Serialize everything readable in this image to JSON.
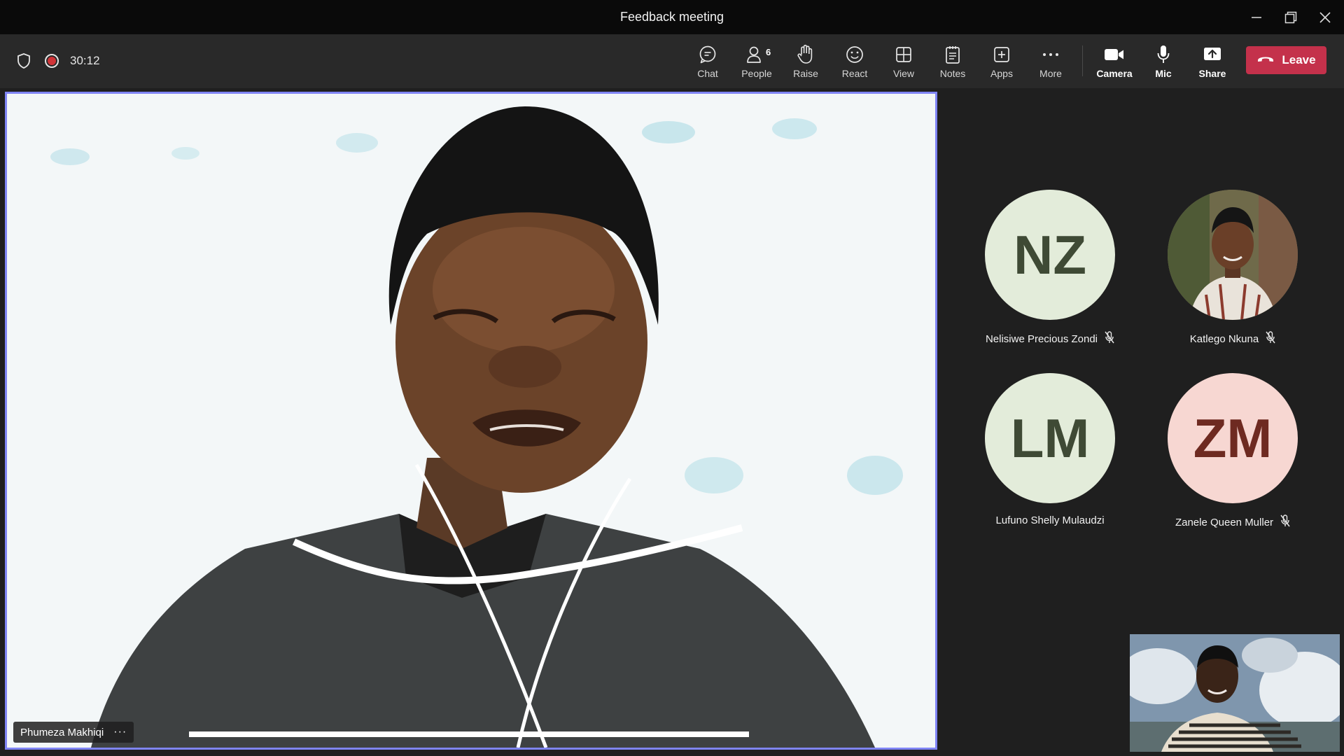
{
  "window": {
    "title": "Feedback meeting"
  },
  "status": {
    "timer": "30:12"
  },
  "toolbar": {
    "chat": "Chat",
    "people": "People",
    "people_count": "6",
    "raise": "Raise",
    "react": "React",
    "view": "View",
    "notes": "Notes",
    "apps": "Apps",
    "more": "More",
    "camera": "Camera",
    "mic": "Mic",
    "share": "Share",
    "leave": "Leave"
  },
  "main_video": {
    "name": "Phumeza Makhiqi",
    "more_glyph": "···"
  },
  "participants": [
    {
      "initials": "NZ",
      "name": "Nelisiwe Precious Zondi",
      "muted": true,
      "avatar_bg": "#e3ecda",
      "avatar_fg": "#3f4a35"
    },
    {
      "initials": "",
      "name": "Katlego Nkuna",
      "muted": true,
      "avatar_bg": "#8b7a62",
      "avatar_fg": "#ffffff"
    },
    {
      "initials": "LM",
      "name": "Lufuno Shelly Mulaudzi",
      "muted": false,
      "avatar_bg": "#e3ecda",
      "avatar_fg": "#3f4a35"
    },
    {
      "initials": "ZM",
      "name": "Zanele Queen Muller",
      "muted": true,
      "avatar_bg": "#f7d7d2",
      "avatar_fg": "#6e2a21"
    }
  ],
  "colors": {
    "accent": "#7f85f5",
    "leave": "#c4314b",
    "recording": "#d13438"
  }
}
